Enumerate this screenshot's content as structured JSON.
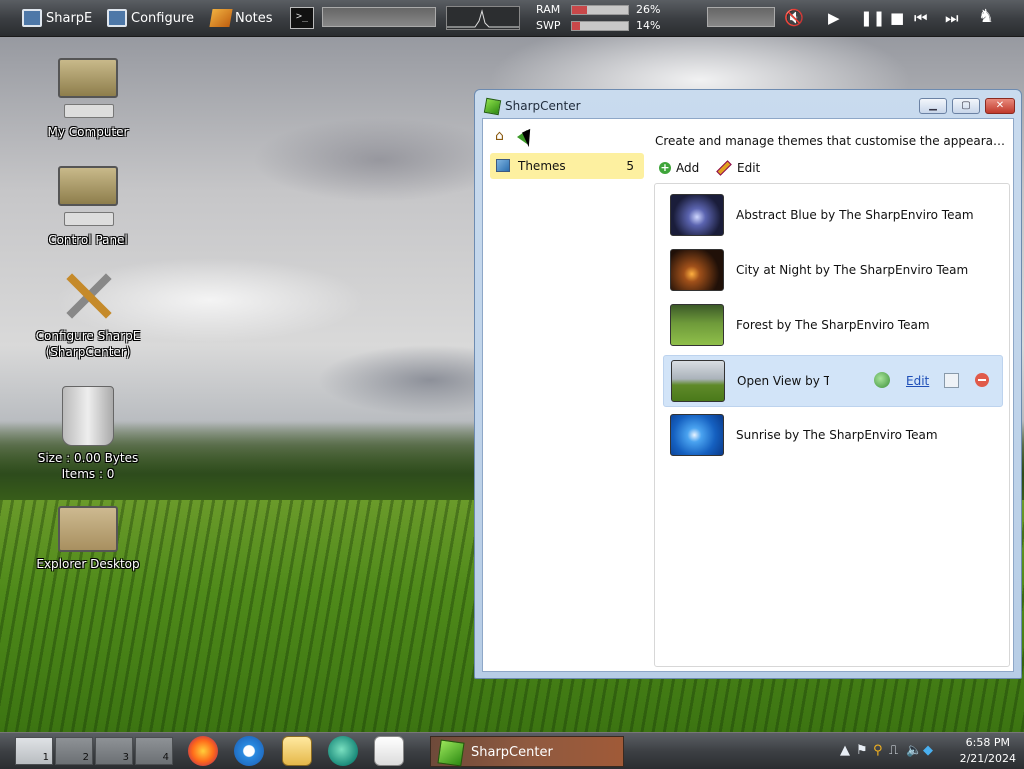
{
  "topbar": {
    "sharpe_label": "SharpE",
    "configure_label": "Configure",
    "notes_label": "Notes",
    "terminal_glyph": ">_",
    "ram_label": "RAM",
    "ram_percent": "26%",
    "ram_value": 0.26,
    "swp_label": "SWP",
    "swp_percent": "14%",
    "swp_value": 0.14
  },
  "desktop_icons": {
    "my_computer": "My Computer",
    "control_panel": "Control Panel",
    "configure_line1": "Configure SharpE",
    "configure_line2": "(SharpCenter)",
    "recycle_size": "Size : 0.00 Bytes",
    "recycle_items": "Items : 0",
    "explorer_desktop": "Explorer Desktop"
  },
  "window": {
    "title": "SharpCenter",
    "nav": {
      "themes_label": "Themes",
      "themes_count": "5"
    },
    "description": "Create and manage themes that customise the appearance of Sh...",
    "actions": {
      "add": "Add",
      "edit": "Edit"
    },
    "themes": [
      {
        "name": "Abstract Blue by The SharpEnviro Team"
      },
      {
        "name": "City at Night by The SharpEnviro Team"
      },
      {
        "name": "Forest by The SharpEnviro Team"
      },
      {
        "name": "Open View by Th",
        "selected": true,
        "edit_link": "Edit"
      },
      {
        "name": "Sunrise by The SharpEnviro Team"
      }
    ]
  },
  "taskbar": {
    "desktops": [
      "1",
      "2",
      "3",
      "4"
    ],
    "task_label": "SharpCenter",
    "time": "6:58 PM",
    "date": "2/21/2024"
  }
}
